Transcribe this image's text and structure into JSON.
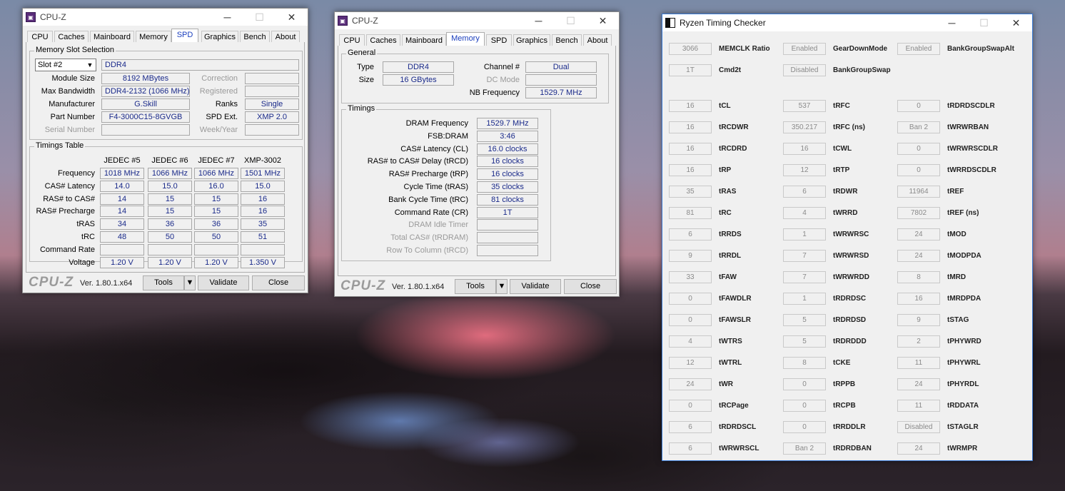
{
  "win1": {
    "title": "CPU-Z",
    "tabs": [
      "CPU",
      "Caches",
      "Mainboard",
      "Memory",
      "SPD",
      "Graphics",
      "Bench",
      "About"
    ],
    "active_tab": "SPD",
    "slot_group": "Memory Slot Selection",
    "slot_select": "Slot #2",
    "mem_type": "DDR4",
    "module_size_label": "Module Size",
    "module_size": "8192 MBytes",
    "max_bw_label": "Max Bandwidth",
    "max_bw": "DDR4-2132 (1066 MHz)",
    "manufacturer_label": "Manufacturer",
    "manufacturer": "G.Skill",
    "part_label": "Part Number",
    "part": "F4-3000C15-8GVGB",
    "serial_label": "Serial Number",
    "serial": "",
    "correction_label": "Correction",
    "correction": "",
    "registered_label": "Registered",
    "registered": "",
    "ranks_label": "Ranks",
    "ranks": "Single",
    "spd_ext_label": "SPD Ext.",
    "spd_ext": "XMP 2.0",
    "week_label": "Week/Year",
    "week": "",
    "timings_group": "Timings Table",
    "cols": [
      "JEDEC #5",
      "JEDEC #6",
      "JEDEC #7",
      "XMP-3002"
    ],
    "rows": [
      {
        "label": "Frequency",
        "values": [
          "1018 MHz",
          "1066 MHz",
          "1066 MHz",
          "1501 MHz"
        ]
      },
      {
        "label": "CAS# Latency",
        "values": [
          "14.0",
          "15.0",
          "16.0",
          "15.0"
        ]
      },
      {
        "label": "RAS# to CAS#",
        "values": [
          "14",
          "15",
          "15",
          "16"
        ]
      },
      {
        "label": "RAS# Precharge",
        "values": [
          "14",
          "15",
          "15",
          "16"
        ]
      },
      {
        "label": "tRAS",
        "values": [
          "34",
          "36",
          "36",
          "35"
        ]
      },
      {
        "label": "tRC",
        "values": [
          "48",
          "50",
          "50",
          "51"
        ]
      },
      {
        "label": "Command Rate",
        "values": [
          "",
          "",
          "",
          ""
        ]
      },
      {
        "label": "Voltage",
        "values": [
          "1.20 V",
          "1.20 V",
          "1.20 V",
          "1.350 V"
        ]
      }
    ],
    "logo": "CPU-Z",
    "version": "Ver. 1.80.1.x64",
    "tools": "Tools",
    "validate": "Validate",
    "close": "Close"
  },
  "win2": {
    "title": "CPU-Z",
    "tabs": [
      "CPU",
      "Caches",
      "Mainboard",
      "Memory",
      "SPD",
      "Graphics",
      "Bench",
      "About"
    ],
    "active_tab": "Memory",
    "general_group": "General",
    "type_label": "Type",
    "type": "DDR4",
    "size_label": "Size",
    "size": "16 GBytes",
    "channel_label": "Channel #",
    "channel": "Dual",
    "dc_label": "DC Mode",
    "dc": "",
    "nb_label": "NB Frequency",
    "nb": "1529.7 MHz",
    "timings_group": "Timings",
    "timings": [
      {
        "label": "DRAM Frequency",
        "value": "1529.7 MHz",
        "gray": false
      },
      {
        "label": "FSB:DRAM",
        "value": "3:46",
        "gray": false
      },
      {
        "label": "CAS# Latency (CL)",
        "value": "16.0 clocks",
        "gray": false
      },
      {
        "label": "RAS# to CAS# Delay (tRCD)",
        "value": "16 clocks",
        "gray": false
      },
      {
        "label": "RAS# Precharge (tRP)",
        "value": "16 clocks",
        "gray": false
      },
      {
        "label": "Cycle Time (tRAS)",
        "value": "35 clocks",
        "gray": false
      },
      {
        "label": "Bank Cycle Time (tRC)",
        "value": "81 clocks",
        "gray": false
      },
      {
        "label": "Command Rate (CR)",
        "value": "1T",
        "gray": false
      },
      {
        "label": "DRAM Idle Timer",
        "value": "",
        "gray": true
      },
      {
        "label": "Total CAS# (tRDRAM)",
        "value": "",
        "gray": true
      },
      {
        "label": "Row To Column (tRCD)",
        "value": "",
        "gray": true
      }
    ],
    "logo": "CPU-Z",
    "version": "Ver. 1.80.1.x64",
    "tools": "Tools",
    "validate": "Validate",
    "close": "Close"
  },
  "rtc": {
    "title": "Ryzen Timing Checker",
    "top": [
      {
        "v1": "3066",
        "l1": "MEMCLK Ratio",
        "v2": "Enabled",
        "l2": "GearDownMode",
        "v3": "Enabled",
        "l3": "BankGroupSwapAlt"
      },
      {
        "v1": "1T",
        "l1": "Cmd2t",
        "v2": "Disabled",
        "l2": "BankGroupSwap",
        "v3": null,
        "l3": null
      }
    ],
    "rows": [
      {
        "v1": "16",
        "l1": "tCL",
        "v2": "537",
        "l2": "tRFC",
        "v3": "0",
        "l3": "tRDRDSCDLR"
      },
      {
        "v1": "16",
        "l1": "tRCDWR",
        "v2": "350.217",
        "l2": "tRFC (ns)",
        "v3": "Ban 2",
        "l3": "tWRWRBAN"
      },
      {
        "v1": "16",
        "l1": "tRCDRD",
        "v2": "16",
        "l2": "tCWL",
        "v3": "0",
        "l3": "tWRWRSCDLR"
      },
      {
        "v1": "16",
        "l1": "tRP",
        "v2": "12",
        "l2": "tRTP",
        "v3": "0",
        "l3": "tWRRDSCDLR"
      },
      {
        "v1": "35",
        "l1": "tRAS",
        "v2": "6",
        "l2": "tRDWR",
        "v3": "11964",
        "l3": "tREF"
      },
      {
        "v1": "81",
        "l1": "tRC",
        "v2": "4",
        "l2": "tWRRD",
        "v3": "7802",
        "l3": "tREF (ns)"
      },
      {
        "v1": "6",
        "l1": "tRRDS",
        "v2": "1",
        "l2": "tWRWRSC",
        "v3": "24",
        "l3": "tMOD"
      },
      {
        "v1": "9",
        "l1": "tRRDL",
        "v2": "7",
        "l2": "tWRWRSD",
        "v3": "24",
        "l3": "tMODPDA"
      },
      {
        "v1": "33",
        "l1": "tFAW",
        "v2": "7",
        "l2": "tWRWRDD",
        "v3": "8",
        "l3": "tMRD"
      },
      {
        "v1": "0",
        "l1": "tFAWDLR",
        "v2": "1",
        "l2": "tRDRDSC",
        "v3": "16",
        "l3": "tMRDPDA"
      },
      {
        "v1": "0",
        "l1": "tFAWSLR",
        "v2": "5",
        "l2": "tRDRDSD",
        "v3": "9",
        "l3": "tSTAG"
      },
      {
        "v1": "4",
        "l1": "tWTRS",
        "v2": "5",
        "l2": "tRDRDDD",
        "v3": "2",
        "l3": "tPHYWRD"
      },
      {
        "v1": "12",
        "l1": "tWTRL",
        "v2": "8",
        "l2": "tCKE",
        "v3": "11",
        "l3": "tPHYWRL"
      },
      {
        "v1": "24",
        "l1": "tWR",
        "v2": "0",
        "l2": "tRPPB",
        "v3": "24",
        "l3": "tPHYRDL"
      },
      {
        "v1": "0",
        "l1": "tRCPage",
        "v2": "0",
        "l2": "tRCPB",
        "v3": "11",
        "l3": "tRDDATA"
      },
      {
        "v1": "6",
        "l1": "tRDRDSCL",
        "v2": "0",
        "l2": "tRRDDLR",
        "v3": "Disabled",
        "l3": "tSTAGLR"
      },
      {
        "v1": "6",
        "l1": "tWRWRSCL",
        "v2": "Ban 2",
        "l2": "tRDRDBAN",
        "v3": "24",
        "l3": "tWRMPR"
      }
    ]
  },
  "icons": {
    "minimize": "minimize-icon",
    "maximize": "maximize-icon",
    "close": "close-icon"
  }
}
